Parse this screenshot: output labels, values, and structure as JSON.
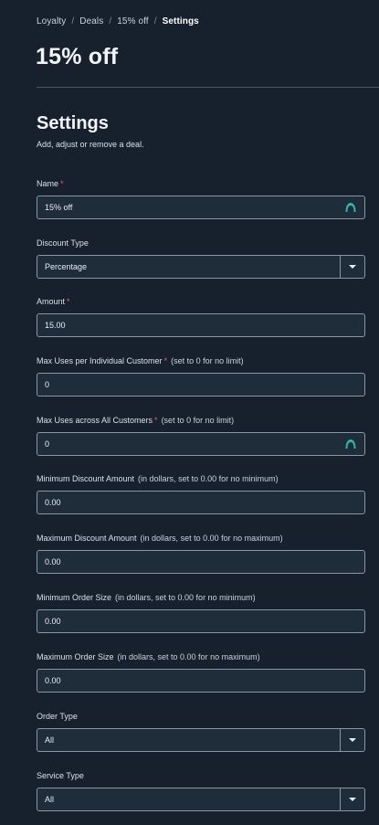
{
  "breadcrumb": {
    "items": [
      "Loyalty",
      "Deals",
      "15% off"
    ],
    "current": "Settings",
    "separator": "/"
  },
  "page_title": "15% off",
  "section": {
    "title": "Settings",
    "subtitle": "Add, adjust or remove a deal."
  },
  "fields": {
    "name": {
      "label": "Name",
      "required": "*",
      "value": "15% off",
      "icon": "password-manager-icon"
    },
    "discount_type": {
      "label": "Discount Type",
      "value": "Percentage"
    },
    "amount": {
      "label": "Amount",
      "required": "*",
      "value": "15.00"
    },
    "max_uses_individual": {
      "label": "Max Uses per Individual Customer",
      "required": "*",
      "hint": "(set to 0 for no limit)",
      "value": "0"
    },
    "max_uses_all": {
      "label": "Max Uses across All Customers",
      "required": "*",
      "hint": "(set to 0 for no limit)",
      "value": "0",
      "icon": "password-manager-icon"
    },
    "min_discount": {
      "label": "Minimum Discount Amount",
      "hint": "(in dollars, set to 0.00 for no minimum)",
      "value": "0.00"
    },
    "max_discount": {
      "label": "Maximum Discount Amount",
      "hint": "(in dollars, set to 0.00 for no maximum)",
      "value": "0.00"
    },
    "min_order": {
      "label": "Minimum Order Size",
      "hint": "(in dollars, set to 0.00 for no minimum)",
      "value": "0.00"
    },
    "max_order": {
      "label": "Maximum Order Size",
      "hint": "(in dollars, set to 0.00 for no maximum)",
      "value": "0.00"
    },
    "order_type": {
      "label": "Order Type",
      "value": "All"
    },
    "service_type": {
      "label": "Service Type",
      "value": "All"
    }
  },
  "colors": {
    "background": "#17212d",
    "input_bg": "#1f2d3b",
    "input_border": "#8896a5",
    "required": "#f05a66",
    "icon_accent": "#2fb3a6"
  }
}
